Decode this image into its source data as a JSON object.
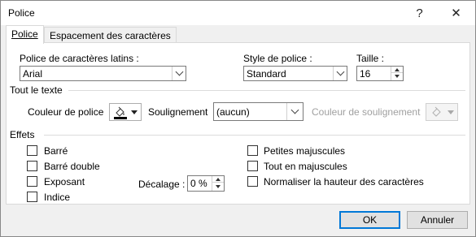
{
  "window": {
    "title": "Police",
    "help_label": "?",
    "close_label": "✕"
  },
  "tabs": [
    {
      "label": "Police",
      "active": true
    },
    {
      "label": "Espacement des caractères",
      "active": false
    }
  ],
  "font": {
    "latin_label": "Police de caractères latins :",
    "latin_value": "Arial",
    "style_label": "Style de police :",
    "style_value": "Standard",
    "size_label": "Taille :",
    "size_value": "16"
  },
  "all_text": {
    "group_label": "Tout le texte",
    "font_color_label": "Couleur de police",
    "underline_label": "Soulignement",
    "underline_value": "(aucun)",
    "underline_color_label": "Couleur de soulignement"
  },
  "effects": {
    "group_label": "Effets",
    "strikethrough": "Barré",
    "double_strikethrough": "Barré double",
    "superscript": "Exposant",
    "subscript": "Indice",
    "offset_label": "Décalage :",
    "offset_value": "0 %",
    "small_caps": "Petites majuscules",
    "all_caps": "Tout en majuscules",
    "equalize_height": "Normaliser la hauteur des caractères"
  },
  "buttons": {
    "ok": "OK",
    "cancel": "Annuler"
  },
  "colors": {
    "accent": "#0078d7",
    "disabled": "#a0a0a0"
  }
}
